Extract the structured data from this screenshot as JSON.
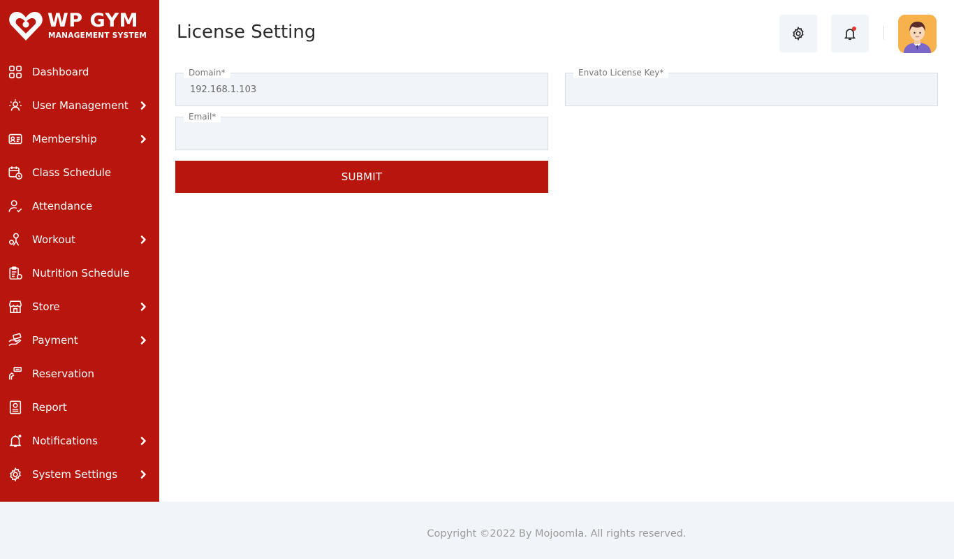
{
  "brand": {
    "title": "WP GYM",
    "subtitle": "MANAGEMENT SYSTEM",
    "color": "#b8160d"
  },
  "sidebar": {
    "items": [
      {
        "label": "Dashboard",
        "icon": "dashboard-icon",
        "has_submenu": false
      },
      {
        "label": "User Management",
        "icon": "user-management-icon",
        "has_submenu": true
      },
      {
        "label": "Membership",
        "icon": "membership-card-icon",
        "has_submenu": true
      },
      {
        "label": "Class Schedule",
        "icon": "calendar-clock-icon",
        "has_submenu": false
      },
      {
        "label": "Attendance",
        "icon": "user-check-icon",
        "has_submenu": false
      },
      {
        "label": "Workout",
        "icon": "workout-icon",
        "has_submenu": true
      },
      {
        "label": "Nutrition Schedule",
        "icon": "nutrition-clipboard-icon",
        "has_submenu": false
      },
      {
        "label": "Store",
        "icon": "store-icon",
        "has_submenu": true
      },
      {
        "label": "Payment",
        "icon": "payment-hand-icon",
        "has_submenu": true
      },
      {
        "label": "Reservation",
        "icon": "reservation-icon",
        "has_submenu": false
      },
      {
        "label": "Report",
        "icon": "report-icon",
        "has_submenu": false
      },
      {
        "label": "Notifications",
        "icon": "bell-icon",
        "has_submenu": true
      },
      {
        "label": "System Settings",
        "icon": "gear-icon",
        "has_submenu": true
      }
    ]
  },
  "header": {
    "title": "License Setting",
    "settings_icon": "gear-icon",
    "notifications_icon": "bell-icon"
  },
  "form": {
    "domain": {
      "label": "Domain*",
      "value": "192.168.1.103"
    },
    "license_key": {
      "label": "Envato License Key*",
      "value": ""
    },
    "email": {
      "label": "Email*",
      "value": ""
    },
    "submit_label": "SUBMIT"
  },
  "footer": {
    "copyright": "Copyright ©2022 By Mojoomla. All rights reserved."
  }
}
